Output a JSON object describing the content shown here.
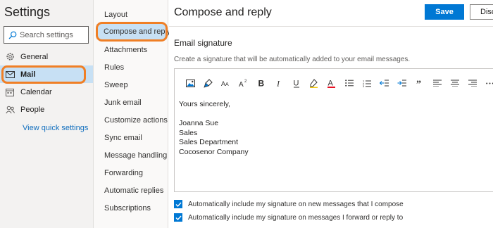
{
  "settings": {
    "title": "Settings"
  },
  "search": {
    "placeholder": "Search settings"
  },
  "nav1": {
    "items": [
      {
        "label": "General",
        "icon": "gear-icon"
      },
      {
        "label": "Mail",
        "icon": "mail-icon",
        "selected": true
      },
      {
        "label": "Calendar",
        "icon": "calendar-icon"
      },
      {
        "label": "People",
        "icon": "people-icon"
      }
    ],
    "quick_link": "View quick settings"
  },
  "nav2": {
    "items": [
      {
        "label": "Layout"
      },
      {
        "label": "Compose and reply",
        "active": true
      },
      {
        "label": "Attachments"
      },
      {
        "label": "Rules"
      },
      {
        "label": "Sweep"
      },
      {
        "label": "Junk email"
      },
      {
        "label": "Customize actions"
      },
      {
        "label": "Sync email"
      },
      {
        "label": "Message handling"
      },
      {
        "label": "Forwarding"
      },
      {
        "label": "Automatic replies"
      },
      {
        "label": "Subscriptions"
      }
    ]
  },
  "main": {
    "title": "Compose and reply",
    "save_label": "Save",
    "discard_label": "Discard",
    "signature_heading": "Email signature",
    "signature_description": "Create a signature that will be automatically added to your email messages."
  },
  "toolbar": {
    "icons": [
      "insert-picture-icon",
      "format-painter-icon",
      "font-size-icon",
      "superscript-icon",
      "bold-icon",
      "italic-icon",
      "underline-icon",
      "highlight-icon",
      "font-color-icon",
      "bullets-icon",
      "numbering-icon",
      "decrease-indent-icon",
      "increase-indent-icon",
      "quote-icon",
      "align-left-icon",
      "align-center-icon",
      "align-right-icon",
      "more-options-icon"
    ]
  },
  "signature": {
    "lines": [
      "Yours sincerely,",
      "",
      "Joanna Sue",
      "Sales",
      "Sales Department",
      "Cocosenor Company"
    ]
  },
  "options": {
    "new_messages": {
      "label": "Automatically include my signature on new messages that I compose",
      "checked": true
    },
    "forward_reply": {
      "label": "Automatically include my signature on messages I forward or reply to",
      "checked": true
    }
  },
  "colors": {
    "accent": "#0078d4",
    "highlight": "#f07f25",
    "selected_bg": "#c7e0f4",
    "link": "#106ebe"
  }
}
